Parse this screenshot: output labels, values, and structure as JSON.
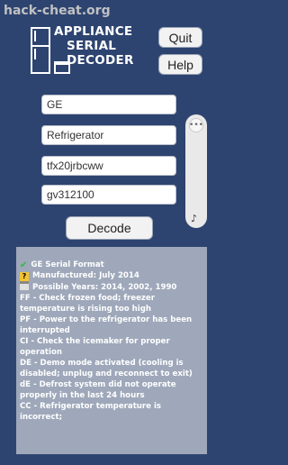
{
  "watermark": "hack-cheat.org",
  "logo": {
    "lines": [
      "APPLIANCE",
      "SERIAL",
      "DECODER"
    ]
  },
  "buttons": {
    "quit": "Quit",
    "help": "Help",
    "decode": "Decode"
  },
  "inputs": {
    "brand": "GE",
    "appliance": "Refrigerator",
    "model": "tfx20jrbcww",
    "serial": "gv312100"
  },
  "scroll": {
    "knob_icon": "•••",
    "note_icon": "♪"
  },
  "output": {
    "format": "GE Serial Format",
    "manufactured": "Manufactured: July 2014",
    "possible_years": "Possible Years: 2014, 2002, 1990",
    "lines": [
      "FF - Check frozen food; freezer temperature is rising too high",
      "PF - Power to the refrigerator has been interrupted",
      "CI - Check the icemaker for proper operation",
      "DE - Demo mode activated (cooling is disabled; unplug and reconnect to exit)",
      "dE - Defrost system did not operate properly in the last 24 hours",
      "CC - Refrigerator temperature is incorrect;"
    ]
  }
}
